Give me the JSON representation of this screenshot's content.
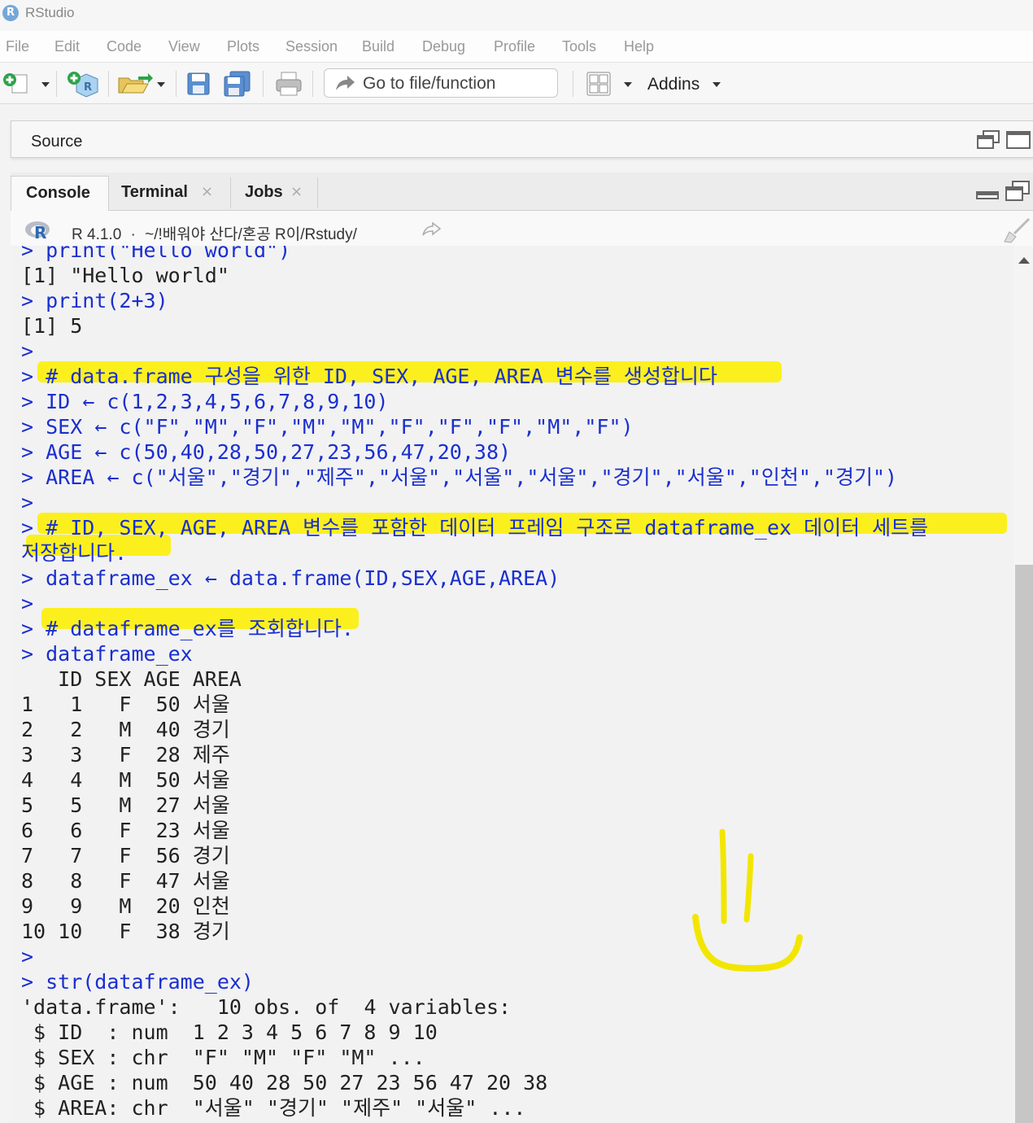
{
  "app": {
    "logo_letter": "R",
    "title": "RStudio"
  },
  "menu": [
    "File",
    "Edit",
    "Code",
    "View",
    "Plots",
    "Session",
    "Build",
    "Debug",
    "Profile",
    "Tools",
    "Help"
  ],
  "toolbar": {
    "icons": [
      "new-file-icon",
      "new-project-icon",
      "open-file-icon",
      "save-icon",
      "save-all-icon",
      "print-icon",
      "workspace-panes-icon"
    ],
    "goto_placeholder": "Go to file/function",
    "addins_label": "Addins"
  },
  "source_pane": {
    "label": "Source"
  },
  "console_tabs": [
    {
      "label": "Console",
      "closable": false
    },
    {
      "label": "Terminal",
      "closable": true
    },
    {
      "label": "Jobs",
      "closable": true
    }
  ],
  "tab_close_glyph": "×",
  "console_header": {
    "r_version": "R 4.1.0",
    "separator": "·",
    "path": "~/!배워야 산다/혼공 R이/Rstudy/"
  },
  "console_lines": [
    {
      "text": "> print(\"Hello world\")",
      "style": "blue",
      "partial": true
    },
    {
      "text": "[1] \"Hello world\"",
      "style": "black"
    },
    {
      "text": "> print(2+3)",
      "style": "blue"
    },
    {
      "text": "[1] 5",
      "style": "black"
    },
    {
      "text": ">",
      "style": "blue"
    },
    {
      "text": "> # data.frame 구성을 위한 ID, SEX, AGE, AREA 변수를 생성합니다",
      "style": "blue"
    },
    {
      "text": "> ID ← c(1,2,3,4,5,6,7,8,9,10)",
      "style": "blue"
    },
    {
      "text": "> SEX ← c(\"F\",\"M\",\"F\",\"M\",\"M\",\"F\",\"F\",\"F\",\"M\",\"F\")",
      "style": "blue"
    },
    {
      "text": "> AGE ← c(50,40,28,50,27,23,56,47,20,38)",
      "style": "blue"
    },
    {
      "text": "> AREA ← c(\"서울\",\"경기\",\"제주\",\"서울\",\"서울\",\"서울\",\"경기\",\"서울\",\"인천\",\"경기\")",
      "style": "blue"
    },
    {
      "text": ">",
      "style": "blue"
    },
    {
      "text": "> # ID, SEX, AGE, AREA 변수를 포함한 데이터 프레임 구조로 dataframe_ex 데이터 세트를",
      "style": "blue"
    },
    {
      "text": "저장합니다.",
      "style": "blue"
    },
    {
      "text": "> dataframe_ex ← data.frame(ID,SEX,AGE,AREA)",
      "style": "blue"
    },
    {
      "text": ">",
      "style": "blue"
    },
    {
      "text": "> # dataframe_ex를 조회합니다.",
      "style": "blue"
    },
    {
      "text": "> dataframe_ex",
      "style": "blue"
    },
    {
      "text": "   ID SEX AGE AREA",
      "style": "black"
    },
    {
      "text": "1   1   F  50 서울",
      "style": "black"
    },
    {
      "text": "2   2   M  40 경기",
      "style": "black"
    },
    {
      "text": "3   3   F  28 제주",
      "style": "black"
    },
    {
      "text": "4   4   M  50 서울",
      "style": "black"
    },
    {
      "text": "5   5   M  27 서울",
      "style": "black"
    },
    {
      "text": "6   6   F  23 서울",
      "style": "black"
    },
    {
      "text": "7   7   F  56 경기",
      "style": "black"
    },
    {
      "text": "8   8   F  47 서울",
      "style": "black"
    },
    {
      "text": "9   9   M  20 인천",
      "style": "black"
    },
    {
      "text": "10 10   F  38 경기",
      "style": "black"
    },
    {
      "text": ">",
      "style": "blue"
    },
    {
      "text": "> str(dataframe_ex)",
      "style": "blue"
    },
    {
      "text": "'data.frame':\t10 obs. of  4 variables:",
      "style": "black"
    },
    {
      "text": " $ ID  : num  1 2 3 4 5 6 7 8 9 10",
      "style": "black"
    },
    {
      "text": " $ SEX : chr  \"F\" \"M\" \"F\" \"M\" ...",
      "style": "black"
    },
    {
      "text": " $ AGE : num  50 40 28 50 27 23 56 47 20 38",
      "style": "black"
    },
    {
      "text": " $ AREA: chr  \"서울\" \"경기\" \"제주\" \"서울\" ...",
      "style": "black"
    }
  ],
  "colors": {
    "input_blue": "#1a2fd0",
    "highlight_yellow": "#fbf01e",
    "output_black": "#222222"
  }
}
